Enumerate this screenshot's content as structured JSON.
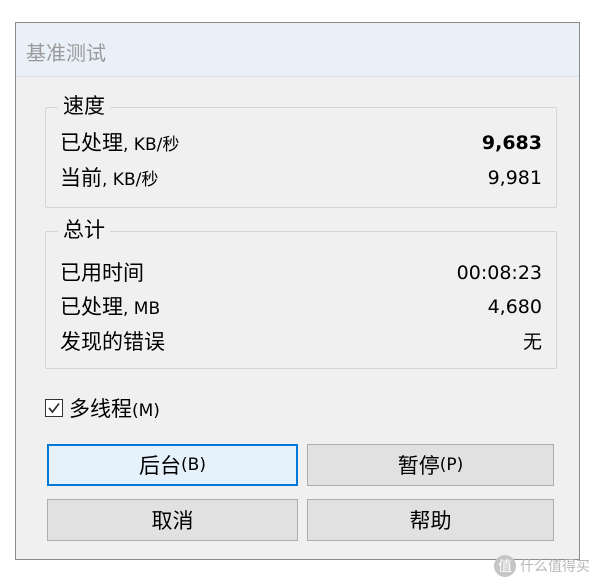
{
  "window": {
    "title": "基准测试"
  },
  "speed": {
    "title": "速度",
    "rows": [
      {
        "label": "已处理",
        "unit": ", KB/秒",
        "value": "9,683"
      },
      {
        "label": "当前",
        "unit": ", KB/秒",
        "value": "9,981"
      }
    ]
  },
  "total": {
    "title": "总计",
    "rows": [
      {
        "label": "已用时间",
        "unit": "",
        "value": "00:08:23"
      },
      {
        "label": "已处理",
        "unit": ", MB",
        "value": "4,680"
      },
      {
        "label": "发现的错误",
        "unit": "",
        "value": "无"
      }
    ]
  },
  "multithread": {
    "label": "多线程",
    "mnemonic": "(M)",
    "checked": true
  },
  "buttons": {
    "background": {
      "label": "后台",
      "mnemonic": "(B)"
    },
    "pause": {
      "label": "暂停",
      "mnemonic": "(P)"
    },
    "cancel": {
      "label": "取消"
    },
    "help": {
      "label": "帮助"
    }
  },
  "watermark": {
    "icon": "值",
    "text": "什么值得买"
  },
  "colors": {
    "default_button_border": "#0078d7",
    "window_bg": "#f0f0f0"
  }
}
